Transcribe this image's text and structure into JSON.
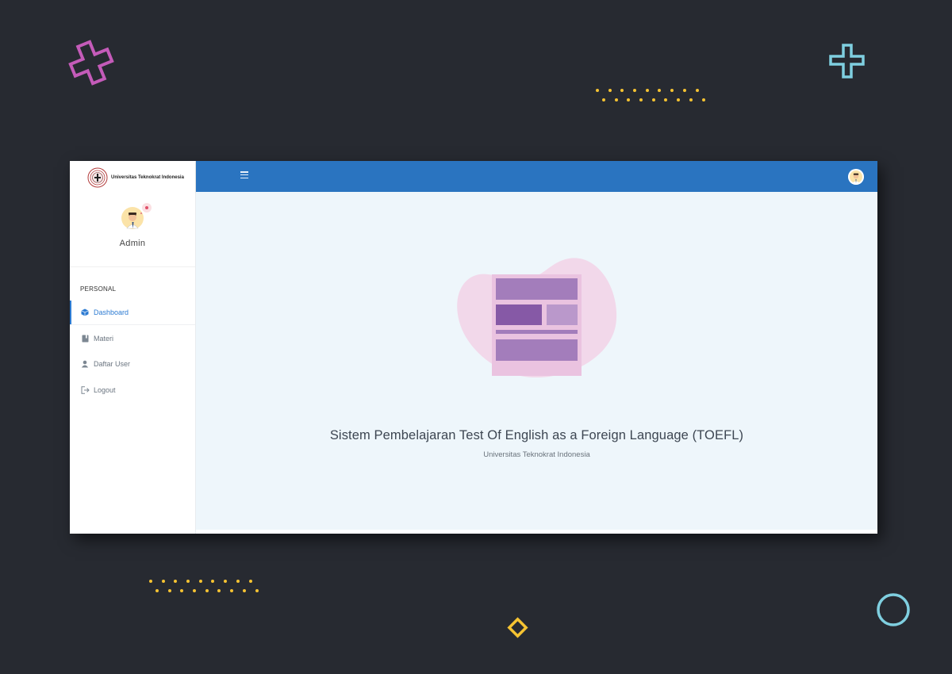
{
  "colors": {
    "background": "#272a31",
    "topbar": "#2a74c0",
    "accent": "#2d7bd2",
    "content_bg": "#eef6fb",
    "decor_pink": "#c45bb9",
    "decor_cyan": "#7fcfe0",
    "decor_yellow": "#f5c332"
  },
  "sidebar": {
    "brand_name": "Universitas Teknokrat Indonesia",
    "logo_icon": "university-logo",
    "profile_name": "Admin",
    "section_label": "PERSONAL",
    "items": [
      {
        "label": "Dashboard",
        "icon": "cube-icon",
        "active": true
      },
      {
        "label": "Materi",
        "icon": "book-icon",
        "active": false
      },
      {
        "label": "Daftar User",
        "icon": "user-icon",
        "active": false
      },
      {
        "label": "Logout",
        "icon": "logout-icon",
        "active": false
      }
    ]
  },
  "topbar": {
    "menu_icon": "hamburger-icon",
    "avatar_icon": "user-avatar"
  },
  "main": {
    "title": "Sistem Pembelajaran Test Of English as a Foreign Language (TOEFL)",
    "subtitle": "Universitas Teknokrat Indonesia",
    "illustration": "document-layout-illustration"
  }
}
